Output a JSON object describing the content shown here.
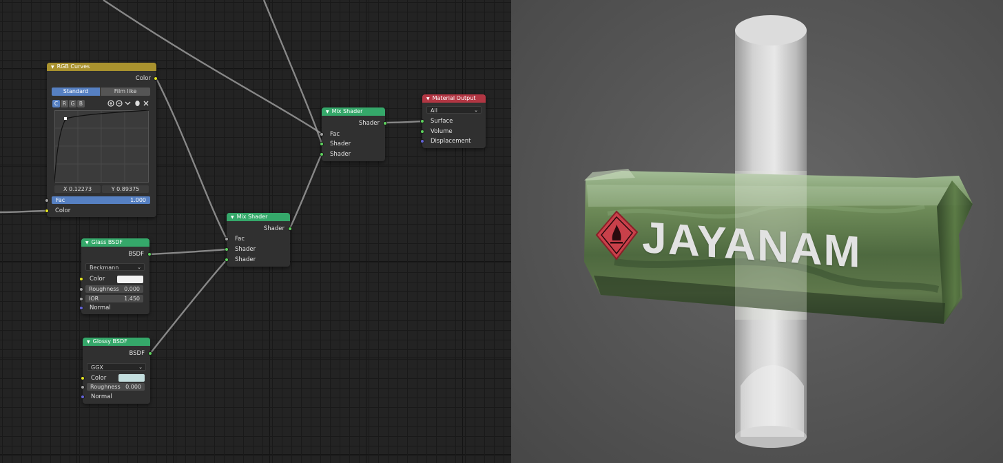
{
  "nodes": {
    "rgb_curves": {
      "title": "RGB Curves",
      "output": "Color",
      "tabs": [
        "Standard",
        "Film like"
      ],
      "channels": [
        "C",
        "R",
        "G",
        "B"
      ],
      "x_readout": "X 0.12273",
      "y_readout": "Y 0.89375",
      "fac_label": "Fac",
      "fac_value": "1.000",
      "fac_fill": 1.0,
      "input_color": "Color"
    },
    "glass_bsdf": {
      "title": "Glass BSDF",
      "output": "BSDF",
      "distribution": "Beckmann",
      "color_label": "Color",
      "color_value": "#f2f2f2",
      "roughness_label": "Roughness",
      "roughness_value": "0.000",
      "ior_label": "IOR",
      "ior_value": "1.450",
      "normal_label": "Normal"
    },
    "glossy_bsdf": {
      "title": "Glossy BSDF",
      "output": "BSDF",
      "distribution": "GGX",
      "color_label": "Color",
      "color_value": "#c4dede",
      "roughness_label": "Roughness",
      "roughness_value": "0.000",
      "normal_label": "Normal"
    },
    "mix_shader_1": {
      "title": "Mix Shader",
      "output": "Shader",
      "inputs": [
        "Fac",
        "Shader",
        "Shader"
      ]
    },
    "mix_shader_2": {
      "title": "Mix Shader",
      "output": "Shader",
      "inputs": [
        "Fac",
        "Shader",
        "Shader"
      ]
    },
    "material_output": {
      "title": "Material Output",
      "target": "All",
      "inputs": [
        "Surface",
        "Volume",
        "Displacement"
      ]
    }
  },
  "viewport": {
    "logo_text": "JAYANAM",
    "hazard_icon": "flame-diamond-icon"
  },
  "colors": {
    "curve_header": "#a9922e",
    "shader_header": "#35a86a",
    "output_header": "#b23643",
    "tab_active": "#5680c2",
    "socket_shader": "#5ed35e",
    "socket_color": "#e6e622",
    "socket_float": "#a3a3a3",
    "socket_vector": "#6464d8",
    "hazard_red": "#c9404a"
  }
}
